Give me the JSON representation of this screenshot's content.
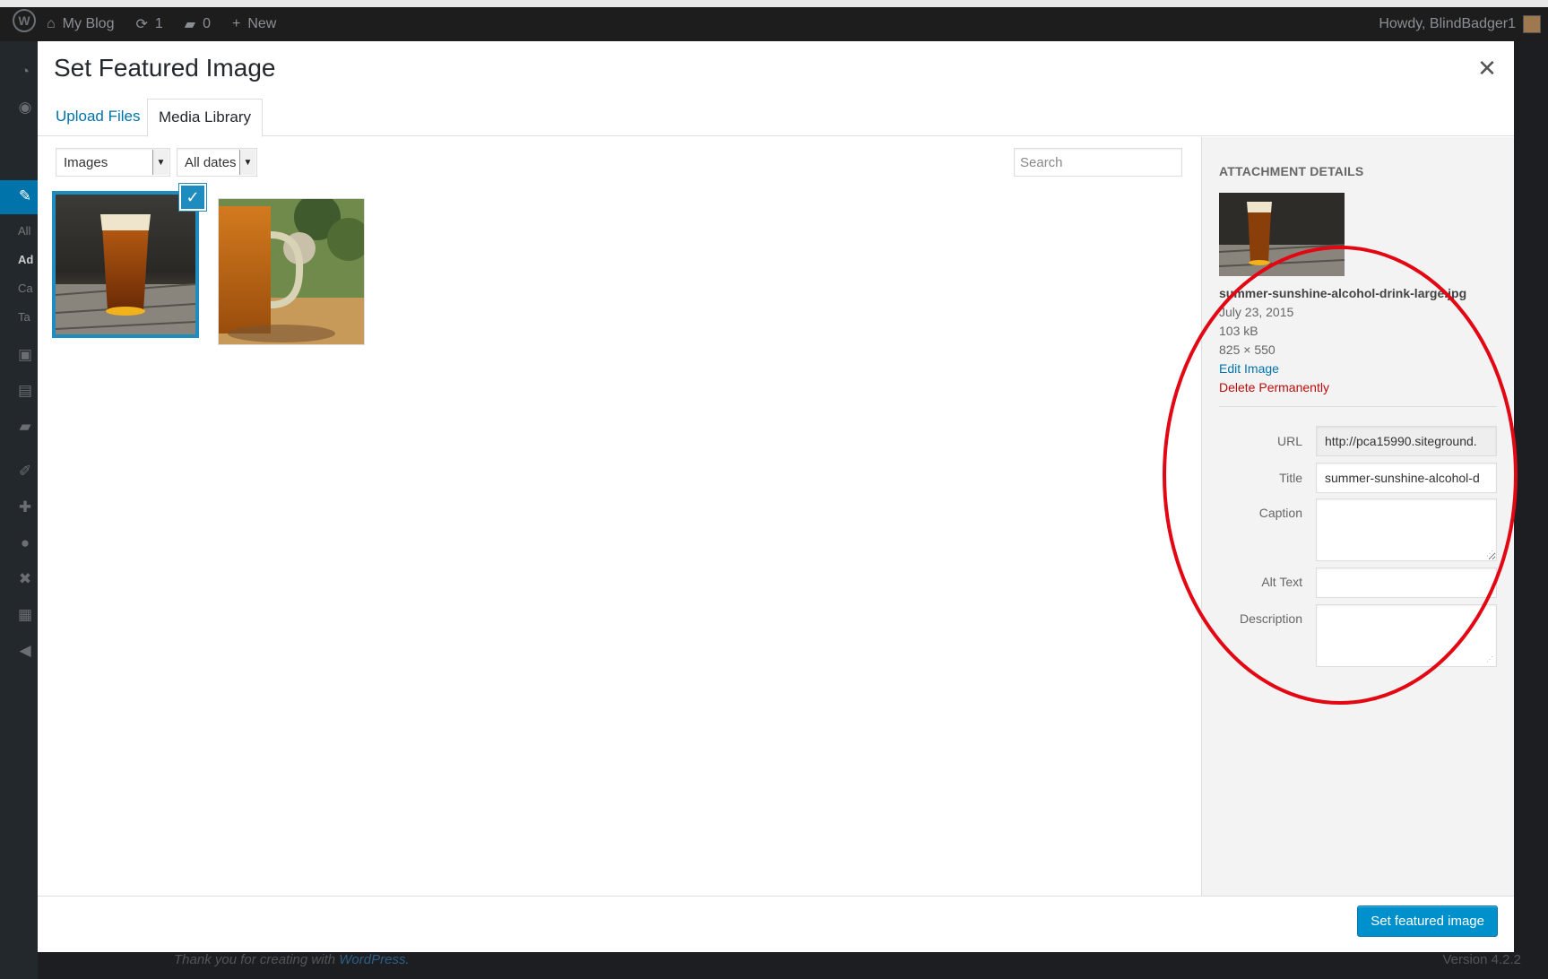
{
  "admin_bar": {
    "site_name": "My Blog",
    "updates_count": "1",
    "comments_count": "0",
    "new_label": "New",
    "greeting": "Howdy, BlindBadger1"
  },
  "admin_menu": {
    "partial_items": [
      "All",
      "Ad",
      "Ca",
      "Ta"
    ]
  },
  "modal": {
    "title": "Set Featured Image",
    "close_icon": "close-icon",
    "tabs": [
      {
        "label": "Upload Files",
        "active": false
      },
      {
        "label": "Media Library",
        "active": true
      }
    ],
    "filters": {
      "type_selected": "Images",
      "date_selected": "All dates"
    },
    "search": {
      "placeholder": "Search",
      "value": ""
    },
    "attachments": [
      {
        "name": "summer-sunshine-alcohol-drink-large.jpg",
        "selected": true
      },
      {
        "name": "beer-mug",
        "selected": false
      }
    ],
    "details": {
      "heading": "Attachment Details",
      "filename": "summer-sunshine-alcohol-drink-large.jpg",
      "date": "July 23, 2015",
      "size": "103 kB",
      "dimensions": "825 × 550",
      "edit_link": "Edit Image",
      "delete_link": "Delete Permanently",
      "fields": {
        "url_label": "URL",
        "url_value": "http://pca15990.siteground.",
        "title_label": "Title",
        "title_value": "summer-sunshine-alcohol-d",
        "caption_label": "Caption",
        "caption_value": "",
        "alt_label": "Alt Text",
        "alt_value": "",
        "description_label": "Description",
        "description_value": ""
      }
    },
    "primary_button": "Set featured image"
  },
  "footer": {
    "thanks_prefix": "Thank you for creating with",
    "thanks_link": "WordPress.",
    "version": "Version 4.2.2"
  },
  "colors": {
    "accent": "#0073aa",
    "selection": "#1e8cbe",
    "button": "#0091cd",
    "delete": "#bc0b0b",
    "annotation": "#e30613",
    "admin_bar": "#1d1d1d"
  }
}
